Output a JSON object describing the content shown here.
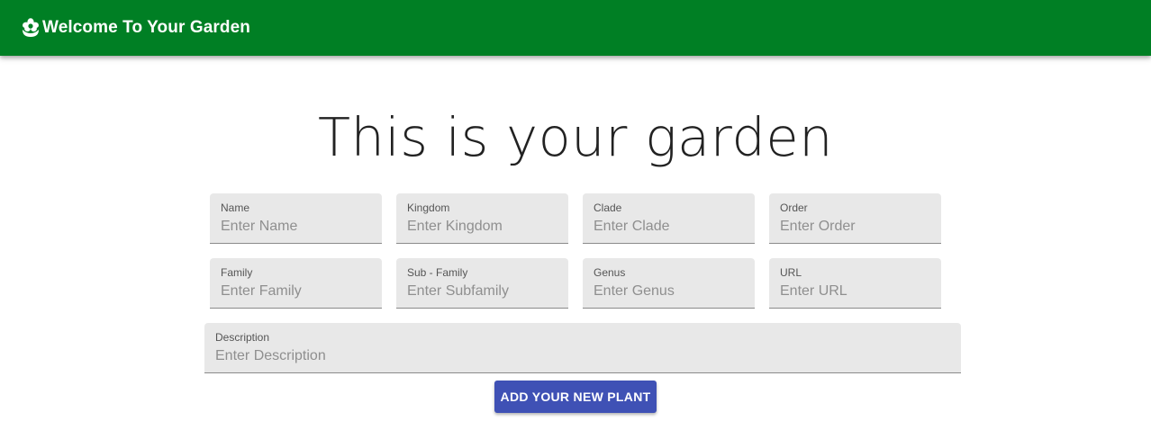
{
  "header": {
    "title": "Welcome To Your Garden",
    "logo_icon": "flower-icon",
    "background": "#007f24"
  },
  "main": {
    "heading": "This is your garden"
  },
  "form": {
    "fields": [
      {
        "label": "Name",
        "placeholder": "Enter Name",
        "value": ""
      },
      {
        "label": "Kingdom",
        "placeholder": "Enter Kingdom",
        "value": ""
      },
      {
        "label": "Clade",
        "placeholder": "Enter Clade",
        "value": ""
      },
      {
        "label": "Order",
        "placeholder": "Enter Order",
        "value": ""
      },
      {
        "label": "Family",
        "placeholder": "Enter Family",
        "value": ""
      },
      {
        "label": "Sub - Family",
        "placeholder": "Enter Subfamily",
        "value": ""
      },
      {
        "label": "Genus",
        "placeholder": "Enter Genus",
        "value": ""
      },
      {
        "label": "URL",
        "placeholder": "Enter URL",
        "value": ""
      },
      {
        "label": "Description",
        "placeholder": "Enter Description",
        "value": ""
      }
    ],
    "submit_label": "ADD YOUR NEW PLANT",
    "submit_color": "#3f51b5"
  }
}
